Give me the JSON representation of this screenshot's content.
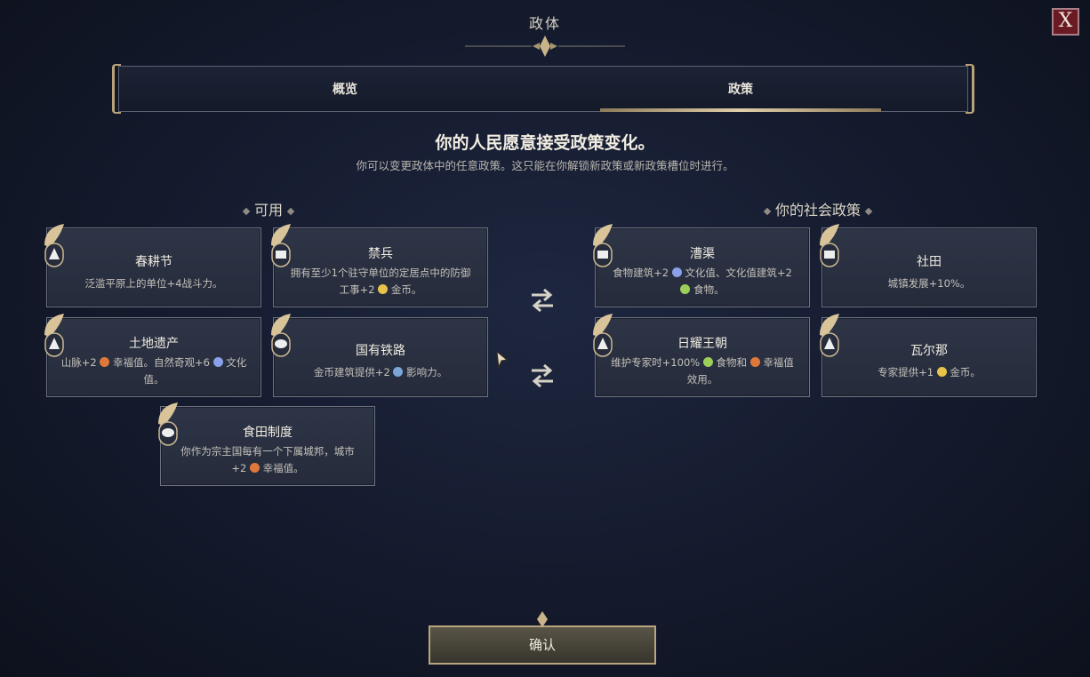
{
  "window": {
    "title": "政体",
    "close_label": "X"
  },
  "tabs": [
    {
      "label": "概览"
    },
    {
      "label": "政策",
      "selected": true
    }
  ],
  "heading": "你的人民愿意接受政策变化。",
  "subheading": "你可以变更政体中的任意政策。这只能在你解锁新政策或新政策槽位时进行。",
  "sections": {
    "available": "可用",
    "social": "你的社会政策"
  },
  "available_cards": [
    {
      "title": "春耕节",
      "desc": "泛滥平原上的单位+4战斗力。",
      "icon": "tree-icon"
    },
    {
      "title": "禁兵",
      "desc_a": "拥有至少1个驻守单位的定居点中的防御工事+2",
      "desc_b": "金币。",
      "icon": "fort-icon"
    },
    {
      "title": "土地遗产",
      "desc_a": "山脉+2",
      "desc_b": "幸福值。自然奇观+6",
      "desc_c": "文化值。",
      "icon": "tree-icon"
    },
    {
      "title": "国有铁路",
      "desc_a": "金币建筑提供+2",
      "desc_b": "影响力。",
      "icon": "elephant-icon"
    },
    {
      "title": "食田制度",
      "desc_a": "你作为宗主国每有一个下属城邦，城市+2",
      "desc_b": "幸福值。",
      "icon": "elephant-icon"
    }
  ],
  "social_cards": [
    {
      "title": "漕渠",
      "desc_a": "食物建筑+2",
      "desc_b": "文化值、文化值建筑+2",
      "desc_c": "食物。",
      "icon": "fort-icon"
    },
    {
      "title": "社田",
      "desc": "城镇发展+10%。",
      "icon": "fort-icon"
    },
    {
      "title": "日耀王朝",
      "desc_a": "维护专家时+100%",
      "desc_b": "食物和",
      "desc_c": "幸福值效用。",
      "icon": "tree-icon"
    },
    {
      "title": "瓦尔那",
      "desc_a": "专家提供+1",
      "desc_b": "金币。",
      "icon": "tree-icon"
    }
  ],
  "confirm_label": "确认",
  "colors": {
    "gold": "#b8a47e",
    "culture": "#8aa0e8",
    "food": "#9ccf5a",
    "happiness": "#e0783a",
    "coin": "#e8c34a",
    "influence": "#7aa6d8"
  }
}
